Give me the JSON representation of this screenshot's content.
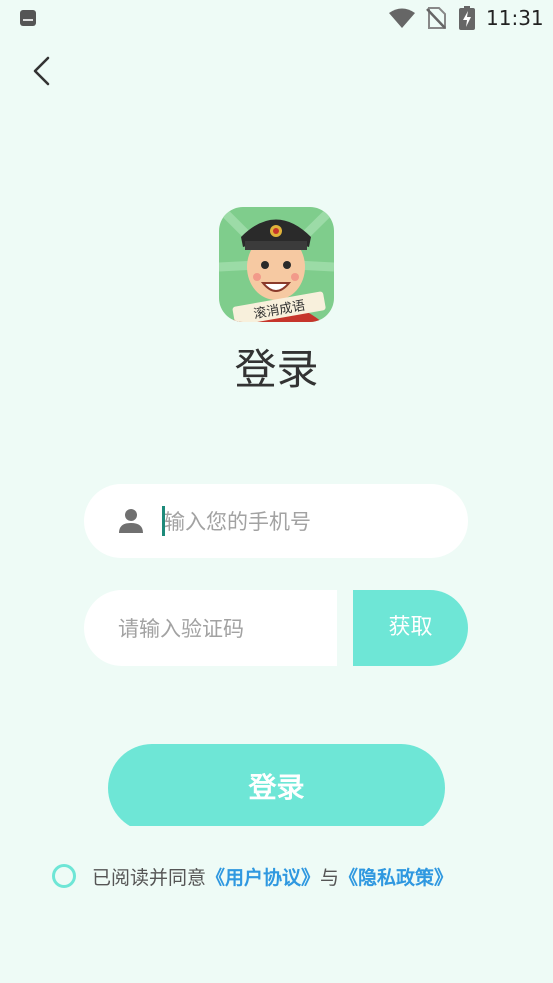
{
  "status_bar": {
    "time": "11:31"
  },
  "title": "登录",
  "logo": {
    "scroll_text": "滚消成语"
  },
  "phone": {
    "placeholder": "输入您的手机号"
  },
  "code": {
    "placeholder": "请输入验证码",
    "get_label": "获取"
  },
  "login_button": "登录",
  "agreement": {
    "prefix": "已阅读并同意",
    "user_agreement": "《用户协议》",
    "conjunction": "与",
    "privacy_policy": "《隐私政策》"
  },
  "colors": {
    "accent": "#6ee6d6",
    "background": "#eefbf6",
    "link": "#2f98e0"
  },
  "icons": [
    "back-icon",
    "user-icon",
    "wifi-icon",
    "no-sim-icon",
    "battery-charging-icon"
  ]
}
